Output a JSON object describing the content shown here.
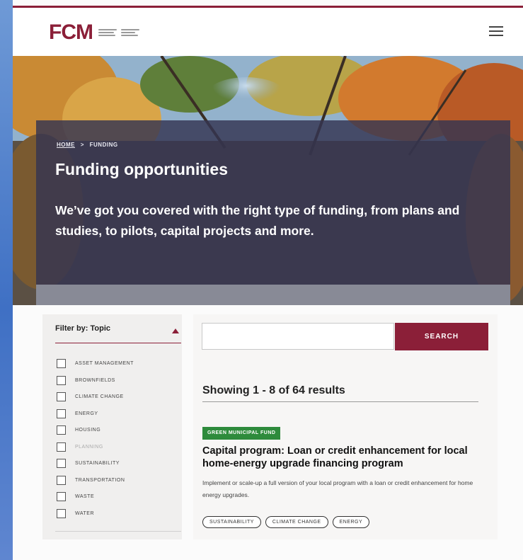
{
  "header": {
    "logo_text": "FCM",
    "menu_icon": "hamburger-menu-icon"
  },
  "hero": {
    "breadcrumb": {
      "home": "HOME",
      "separator": ">",
      "current": "FUNDING"
    },
    "title": "Funding opportunities",
    "text": "We’ve got you covered with the right type of funding, from plans and studies, to pilots, capital projects and more."
  },
  "filter": {
    "heading": "Filter by: Topic",
    "caret_icon": "caret-up-icon",
    "topics": [
      {
        "label": "ASSET MANAGEMENT"
      },
      {
        "label": "BROWNFIELDS"
      },
      {
        "label": "CLIMATE CHANGE"
      },
      {
        "label": "ENERGY"
      },
      {
        "label": "HOUSING"
      },
      {
        "label": "PLANNING"
      },
      {
        "label": "SUSTAINABILITY"
      },
      {
        "label": "TRANSPORTATION"
      },
      {
        "label": "WASTE"
      },
      {
        "label": "WATER"
      }
    ]
  },
  "search": {
    "placeholder": "",
    "button_label": "SEARCH"
  },
  "results": {
    "count_text": "Showing 1 - 8 of 64 results",
    "items": [
      {
        "badge": "GREEN MUNICIPAL FUND",
        "title": "Capital program: Loan or credit enhancement for local home-energy upgrade financing program",
        "description": "Implement or scale-up a full version of your local program with a loan or credit enhancement for home energy upgrades.",
        "tags": [
          "SUSTAINABILITY",
          "CLIMATE CHANGE",
          "ENERGY"
        ]
      }
    ]
  },
  "colors": {
    "brand": "#8b1f38",
    "badge_green": "#2e8b3c",
    "hero_overlay": "#343452"
  }
}
